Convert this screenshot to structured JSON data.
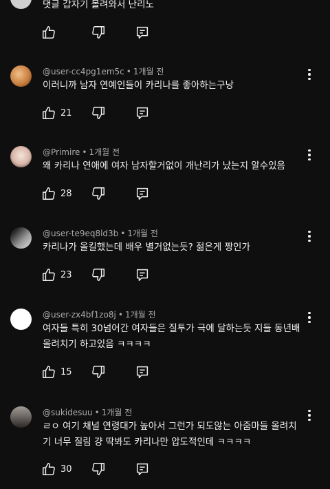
{
  "comments": [
    {
      "author": "",
      "time": "",
      "text": "댓글 갑자기 몰려와서 난리노",
      "likes": "",
      "avatar_color": "#cfcfcf"
    },
    {
      "author": "@user-cc4pg1em5c",
      "time": "1개월 전",
      "text": "이러니까 남자 연예인들이 카리나를 좋아하는구낭",
      "likes": "21",
      "avatar_color": "#c47a3a"
    },
    {
      "author": "@Primire",
      "time": "1개월 전",
      "text": "왜 카리나 연애에 여자 남자할거없이 개난리가 났는지 알수있음",
      "likes": "28",
      "avatar_color": "#e8d6cf"
    },
    {
      "author": "@user-te9eq8ld3b",
      "time": "1개월 전",
      "text": "카리나가 올킬했는데 배우 별거없는듯? 젊은게 짱인가",
      "likes": "23",
      "avatar_color": "#8a8a8a"
    },
    {
      "author": "@user-zx4bf1zo8j",
      "time": "1개월 전",
      "text": "여자들 특히 30넘어간 여자들은 질투가 극에 달하는듯 지들 동년배 올려치기 하고있음 ㅋㅋㅋㅋ",
      "likes": "15",
      "avatar_color": "#ffffff"
    },
    {
      "author": "@sukidesuu",
      "time": "1개월 전",
      "text": "ㄹㅇ 여기 채널 연령대가 높아서 그런가 되도않는 아줌마들 올려치기 너무 질림 걍 딱봐도 카리나만 압도적인데 ㅋㅋㅋㅋ",
      "likes": "30",
      "avatar_color": "#6f6a66"
    }
  ],
  "icons": {
    "more": "more-vert-icon",
    "like": "thumb-up-icon",
    "dislike": "thumb-down-icon",
    "reply": "reply-icon"
  },
  "colors": {
    "background": "#0f0f0f",
    "text": "#f1f1f1",
    "meta": "#aaaaaa"
  }
}
